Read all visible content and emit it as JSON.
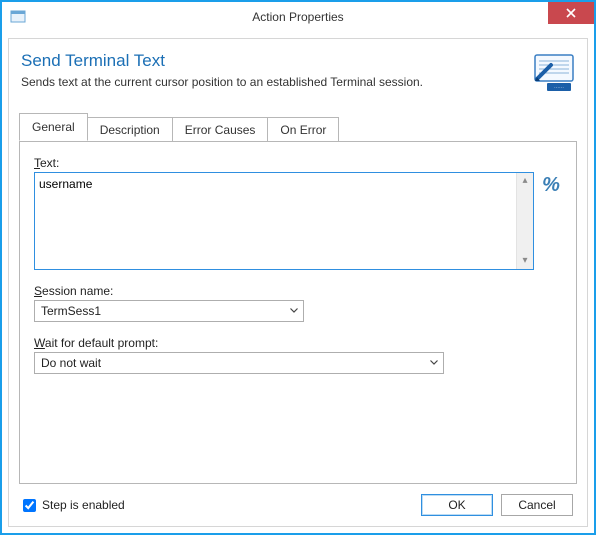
{
  "window": {
    "title": "Action Properties",
    "close_icon": "close-icon"
  },
  "header": {
    "title": "Send Terminal Text",
    "description": "Sends text at the current cursor position to an established Terminal session."
  },
  "tabs": {
    "general": "General",
    "description": "Description",
    "error_causes": "Error Causes",
    "on_error": "On Error",
    "active": "general"
  },
  "general": {
    "text_label_pre": "T",
    "text_label_rest": "ext:",
    "text_value": "username",
    "percent_icon": "%",
    "session_label_pre": "S",
    "session_label_rest": "ession name:",
    "session_value": "TermSess1",
    "wait_label_pre": "W",
    "wait_label_rest": "ait for default prompt:",
    "wait_value": "Do not wait"
  },
  "footer": {
    "step_enabled_label": "Step is enabled",
    "step_enabled_checked": true,
    "ok": "OK",
    "cancel": "Cancel"
  }
}
